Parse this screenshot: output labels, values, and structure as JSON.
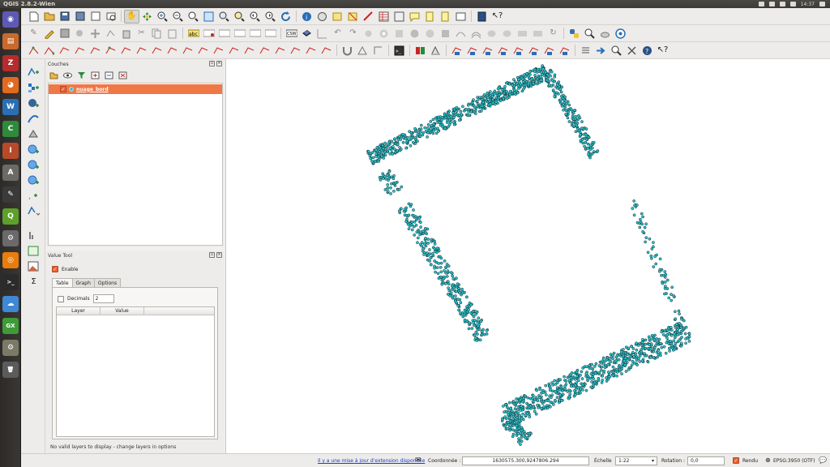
{
  "window": {
    "title": "QGIS 2.8.2-Wien",
    "clock": "14:37"
  },
  "launcher": {
    "apps": [
      {
        "name": "dash",
        "color": "#5d5ab6",
        "glyph": "◉"
      },
      {
        "name": "files",
        "color": "#c8692d",
        "glyph": "▤"
      },
      {
        "name": "filezilla",
        "color": "#b62b2b",
        "glyph": "Z"
      },
      {
        "name": "firefox",
        "color": "#e16a1f",
        "glyph": "◕"
      },
      {
        "name": "writer",
        "color": "#2a6fb5",
        "glyph": "W"
      },
      {
        "name": "calc",
        "color": "#2f8b3b",
        "glyph": "C"
      },
      {
        "name": "impress",
        "color": "#b84a2a",
        "glyph": "I"
      },
      {
        "name": "store",
        "color": "#6c6a66",
        "glyph": "A"
      },
      {
        "name": "inkscape",
        "color": "#3a3a3a",
        "glyph": "✎"
      },
      {
        "name": "qgis",
        "color": "#5da02a",
        "glyph": "Q"
      },
      {
        "name": "transmission",
        "color": "#6a6a6a",
        "glyph": "⚙"
      },
      {
        "name": "blender",
        "color": "#e87d0d",
        "glyph": "◎"
      },
      {
        "name": "terminal",
        "color": "#2b2b2b",
        "glyph": ">_"
      },
      {
        "name": "cloud",
        "color": "#3f88d4",
        "glyph": "☁"
      },
      {
        "name": "gx",
        "color": "#3f9a38",
        "glyph": "GX"
      },
      {
        "name": "settings",
        "color": "#7a7a66",
        "glyph": "⚙"
      },
      {
        "name": "trash",
        "color": "#5b5b5b",
        "glyph": "🗑"
      }
    ]
  },
  "layers_panel": {
    "title": "Couches",
    "layer": {
      "name": "nuage_bord",
      "checked": true
    }
  },
  "value_tool": {
    "title": "Value Tool",
    "enable_label": "Enable",
    "tabs": [
      "Table",
      "Graph",
      "Options"
    ],
    "decimals_label": "Decimals",
    "decimals_value": "2",
    "columns": [
      "Layer",
      "Value"
    ],
    "message": "No valid layers to display - change layers in options"
  },
  "status_bar": {
    "update_link": "Il y a une mise à jour d'extension disponible",
    "coord_label": "Coordonnée :",
    "coord_value": "1630575.300,9247806.294",
    "scale_label": "Échelle",
    "scale_value": "1:22",
    "rotation_label": "Rotation :",
    "rotation_value": "0,0",
    "render_label": "Rendu",
    "crs_label": "EPSG:3950 (OTF)"
  },
  "map": {
    "point_color": "#2ec4cc",
    "point_stroke": "#0a2a30"
  }
}
